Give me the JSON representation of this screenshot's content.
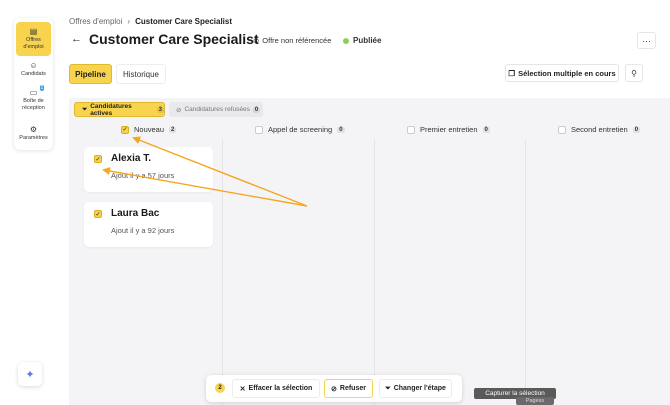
{
  "sidebar": {
    "items": [
      {
        "label": "Offres d'emploi",
        "icon": "clipboard-icon",
        "active": true
      },
      {
        "label": "Candidats",
        "icon": "smile-icon"
      },
      {
        "label": "Boîte de réception",
        "icon": "chat-icon",
        "badge": "1"
      },
      {
        "label": "Paramètres",
        "icon": "gear-icon"
      }
    ]
  },
  "header": {
    "breadcrumb_parent": "Offres d'emploi",
    "breadcrumb_current": "Customer Care Specialist",
    "title": "Customer Care Specialist",
    "unlisted_label": "Offre non référencée",
    "status_label": "Publiée",
    "status_color": "#8bd05a"
  },
  "tabs": {
    "pipeline": "Pipeline",
    "history": "Historique"
  },
  "toolbar": {
    "multi_select_label": "Sélection multiple en cours"
  },
  "filters": {
    "active_label": "Candidatures actives",
    "active_count": "3",
    "refused_label": "Candidatures refusées",
    "refused_count": "0"
  },
  "columns": [
    {
      "label": "Nouveau",
      "count": "2",
      "checked": true
    },
    {
      "label": "Appel de screening",
      "count": "0",
      "checked": false
    },
    {
      "label": "Premier entretien",
      "count": "0",
      "checked": false
    },
    {
      "label": "Second entretien",
      "count": "0",
      "checked": false
    }
  ],
  "cards": [
    {
      "name": "Alexia T.",
      "added": "Ajout il y a 57 jours",
      "checked": true
    },
    {
      "name": "Laura Bac",
      "added": "Ajout il y a 92 jours",
      "checked": true
    }
  ],
  "action_bar": {
    "selected_count": "2",
    "clear_label": "Effacer la sélection",
    "refuse_label": "Refuser",
    "change_stage_label": "Changer l'étape"
  },
  "tooltip": {
    "text": "Capturer la sélection",
    "ghost_text": "Pagess"
  },
  "colors": {
    "accent": "#f7d34e",
    "annotation_arrow": "#f5a623"
  }
}
